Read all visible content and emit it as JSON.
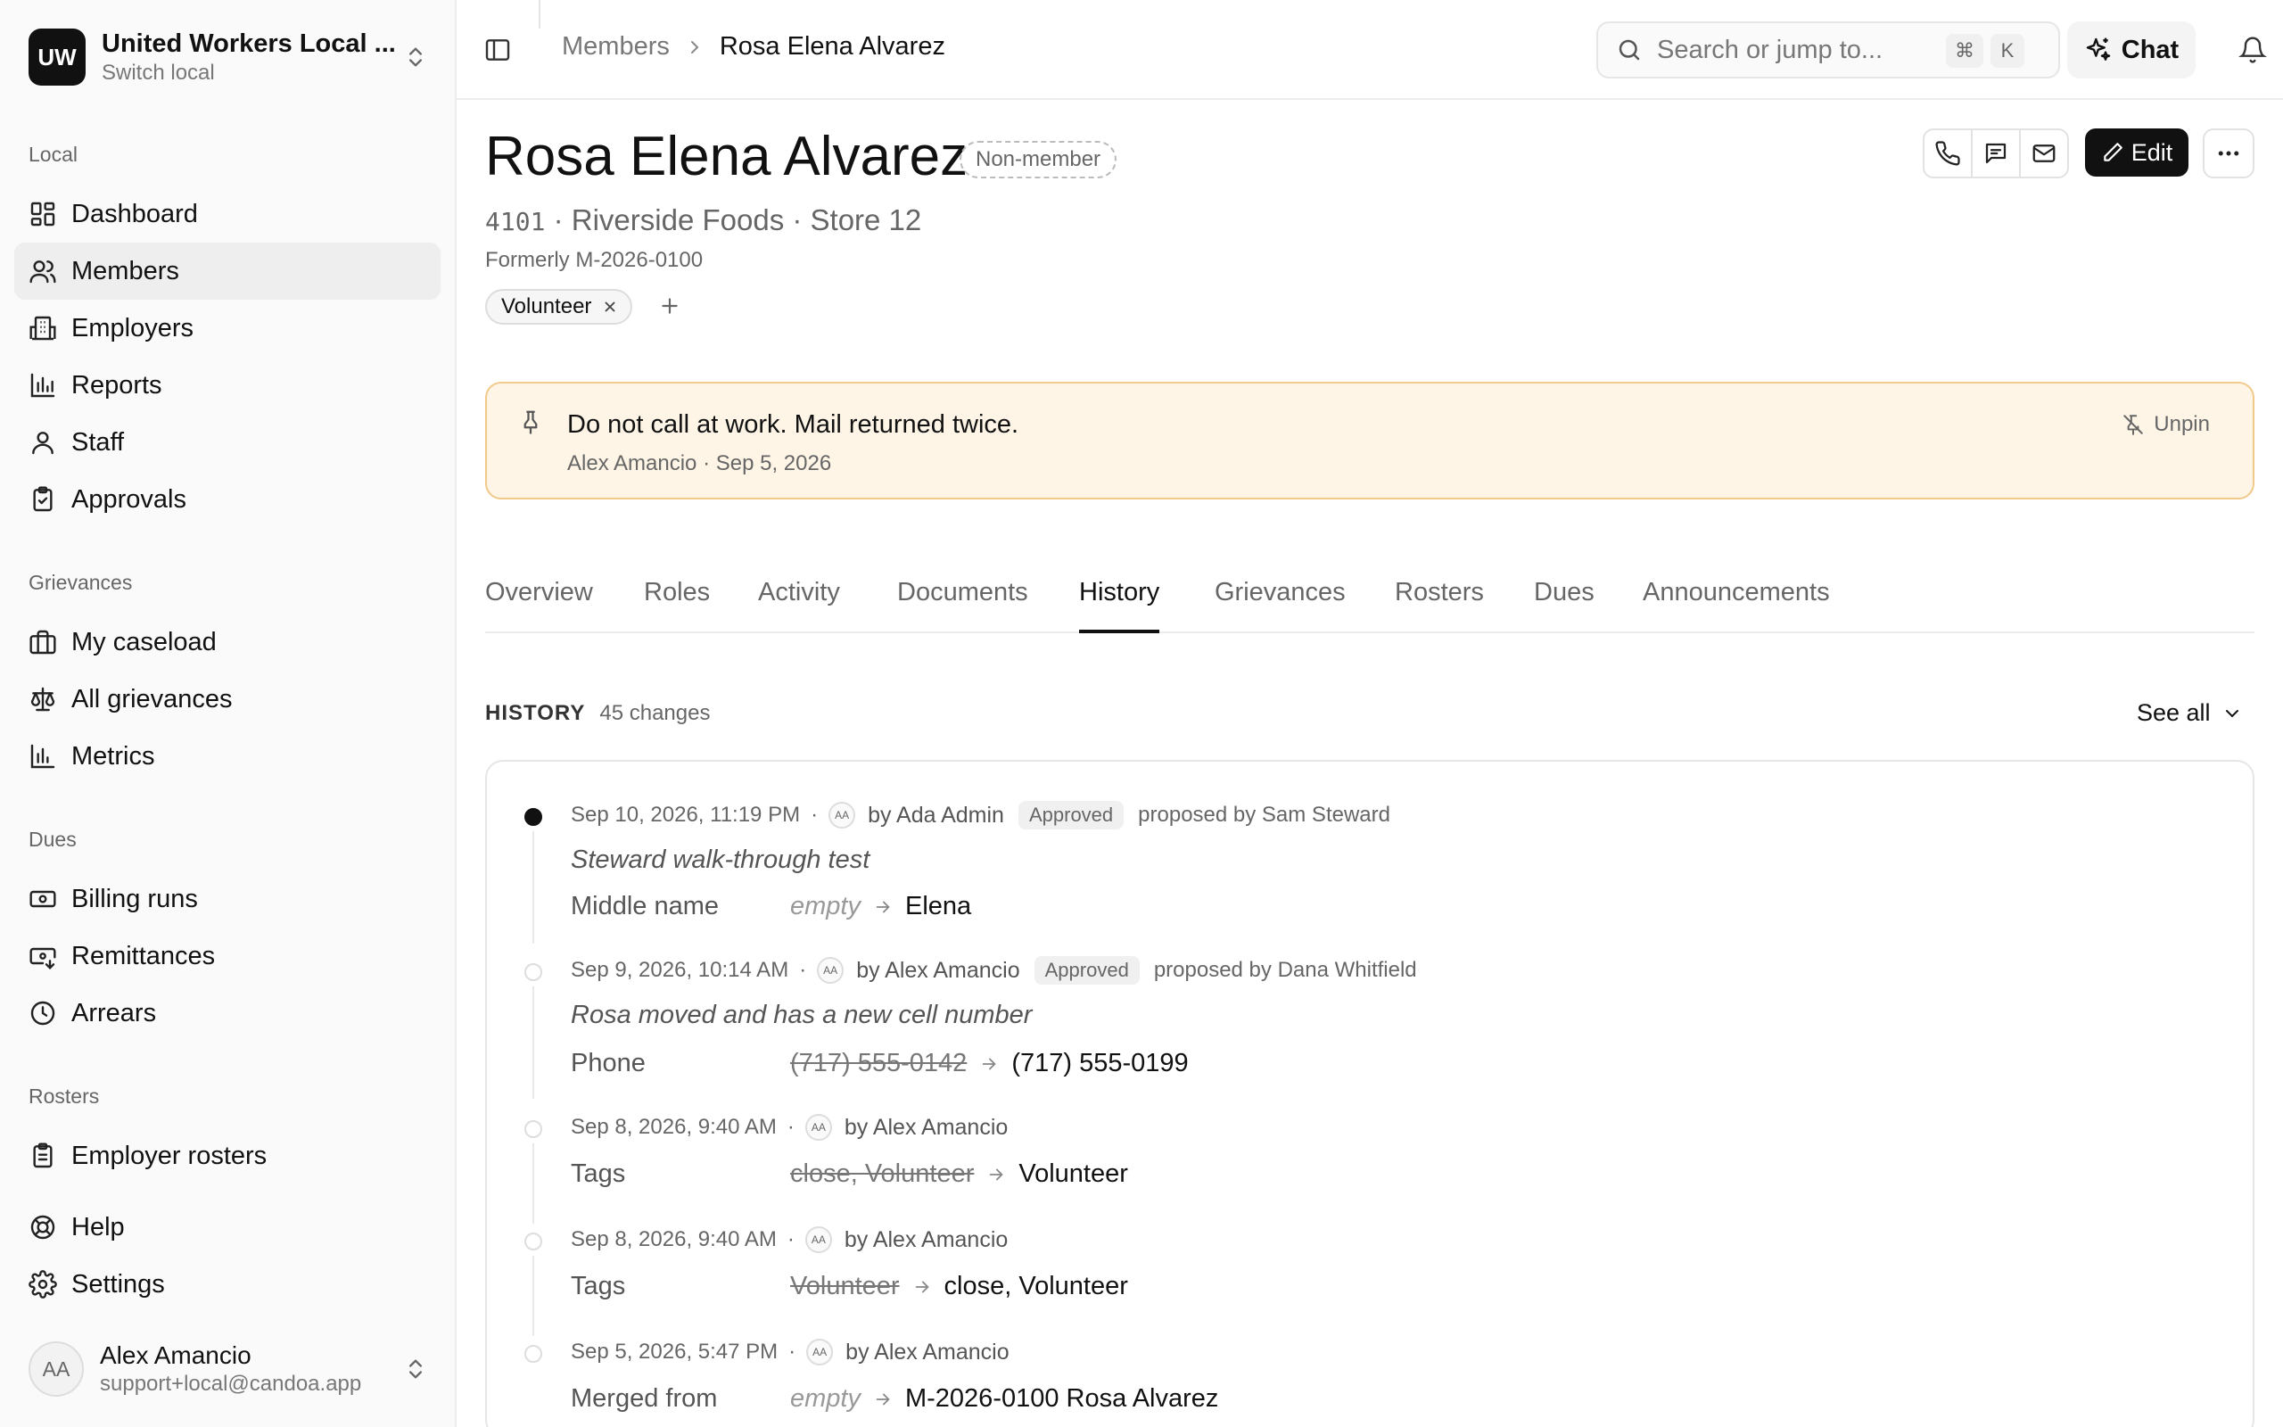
{
  "org": {
    "logo": "UW",
    "name": "United Workers Local ...",
    "sub": "Switch local"
  },
  "nav": {
    "local_label": "Local",
    "local_items": [
      {
        "label": "Dashboard",
        "icon": "dashboard-icon"
      },
      {
        "label": "Members",
        "icon": "users-icon"
      },
      {
        "label": "Employers",
        "icon": "building-icon"
      },
      {
        "label": "Reports",
        "icon": "bar-chart-icon"
      },
      {
        "label": "Staff",
        "icon": "user-icon"
      },
      {
        "label": "Approvals",
        "icon": "clipboard-check-icon"
      }
    ],
    "grievances_label": "Grievances",
    "grievance_items": [
      {
        "label": "My caseload",
        "icon": "briefcase-icon"
      },
      {
        "label": "All grievances",
        "icon": "scale-icon"
      },
      {
        "label": "Metrics",
        "icon": "bar-chart-icon"
      }
    ],
    "dues_label": "Dues",
    "dues_items": [
      {
        "label": "Billing runs",
        "icon": "banknote-icon"
      },
      {
        "label": "Remittances",
        "icon": "receipt-icon"
      },
      {
        "label": "Arrears",
        "icon": "clock-icon"
      }
    ],
    "rosters_label": "Rosters",
    "roster_items": [
      {
        "label": "Employer rosters",
        "icon": "clipboard-list-icon"
      }
    ],
    "footer_items": [
      {
        "label": "Help",
        "icon": "lifebuoy-icon"
      },
      {
        "label": "Settings",
        "icon": "gear-icon"
      }
    ]
  },
  "user": {
    "initials": "AA",
    "name": "Alex Amancio",
    "email": "support+local@candoa.app"
  },
  "topbar": {
    "breadcrumb_parent": "Members",
    "breadcrumb_current": "Rosa Elena Alvarez",
    "search_placeholder": "Search or jump to...",
    "kbd_cmd": "⌘",
    "kbd_k": "K",
    "chat_label": "Chat"
  },
  "member": {
    "name": "Rosa Elena Alvarez",
    "status": "Non-member",
    "number": "4101",
    "employer_line": " · Riverside Foods · Store 12",
    "formerly": "Formerly M-2026-0100",
    "tag": "Volunteer",
    "edit_label": "Edit"
  },
  "note": {
    "text": "Do not call at work. Mail returned twice.",
    "meta": "Alex Amancio · Sep 5, 2026",
    "unpin_label": "Unpin"
  },
  "tabs": [
    "Overview",
    "Roles",
    "Activity",
    "Documents",
    "History",
    "Grievances",
    "Rosters",
    "Dues",
    "Announcements"
  ],
  "active_tab": "History",
  "history": {
    "title": "HISTORY",
    "count": "45 changes",
    "see_all": "See all",
    "entries": [
      {
        "time": "Sep 10, 2026, 11:19 PM",
        "by": "by Ada Admin",
        "avatar": "AA",
        "status": "Approved",
        "proposed": "proposed by Sam Steward",
        "reason": "Steward walk-through test",
        "field": "Middle name",
        "old": "empty",
        "new": "Elena"
      },
      {
        "time": "Sep 9, 2026, 10:14 AM",
        "by": "by Alex Amancio",
        "avatar": "AA",
        "status": "Approved",
        "proposed": "proposed by Dana Whitfield",
        "reason": "Rosa moved and has a new cell number",
        "field": "Phone",
        "old": "(717) 555-0142",
        "new": "(717) 555-0199"
      },
      {
        "time": "Sep 8, 2026, 9:40 AM",
        "by": "by Alex Amancio",
        "avatar": "AA",
        "field": "Tags",
        "old": "close, Volunteer",
        "new": "Volunteer"
      },
      {
        "time": "Sep 8, 2026, 9:40 AM",
        "by": "by Alex Amancio",
        "avatar": "AA",
        "field": "Tags",
        "old": "Volunteer",
        "new": "close, Volunteer"
      },
      {
        "time": "Sep 5, 2026, 5:47 PM",
        "by": "by Alex Amancio",
        "avatar": "AA",
        "field": "Merged from",
        "old": "empty",
        "new": "M-2026-0100 Rosa Alvarez"
      }
    ]
  },
  "separator": "·"
}
